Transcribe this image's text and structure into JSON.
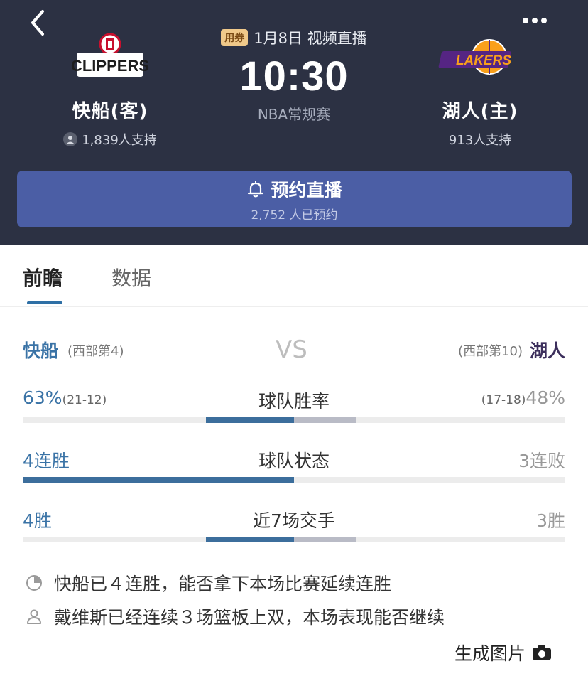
{
  "header": {
    "coupon_label": "用券",
    "date_text": "1月8日 视频直播",
    "time": "10:30",
    "league": "NBA常规赛",
    "away": {
      "logo_text": "CLIPPERS",
      "name": "快船(客)",
      "support": "1,839人支持"
    },
    "home": {
      "logo_text": "LAKERS",
      "name": "湖人(主)",
      "support": "913人支持"
    },
    "reserve": {
      "label": "预约直播",
      "count": "2,752 人已预约"
    }
  },
  "tabs": [
    {
      "label": "前瞻",
      "active": true
    },
    {
      "label": "数据",
      "active": false
    }
  ],
  "versus": {
    "away_name": "快船",
    "away_rank": "(西部第4)",
    "vs": "VS",
    "home_rank": "(西部第10)",
    "home_name": "湖人"
  },
  "stats": [
    {
      "title": "球队胜率",
      "left_value": "63%",
      "left_sub": "(21-12)",
      "right_value": "48%",
      "right_sub": "(17-18)",
      "left_fraction": 0.57,
      "right_fraction": 0.43
    },
    {
      "title": "球队状态",
      "left_value": "4连胜",
      "left_sub": "",
      "right_value": "3连败",
      "right_sub": "",
      "left_fraction": 1.0,
      "right_fraction": 0.0
    },
    {
      "title": "近7场交手",
      "left_value": "4胜",
      "left_sub": "",
      "right_value": "3胜",
      "right_sub": "",
      "left_fraction": 0.57,
      "right_fraction": 0.43
    }
  ],
  "notes": [
    {
      "icon": "pie-chart-icon",
      "text": "快船已４连胜，能否拿下本场比赛延续连胜"
    },
    {
      "icon": "person-icon",
      "text": "戴维斯已经连续３场篮板上双，本场表现能否继续"
    }
  ],
  "footer": {
    "generate_image_label": "生成图片"
  },
  "colors": {
    "header_bg": "#2c3143",
    "reserve_bg": "#4b5ea5",
    "away_accent": "#3c6e9c",
    "home_accent": "#b9bbc6",
    "tab_active_underline": "#2e6fa5"
  }
}
